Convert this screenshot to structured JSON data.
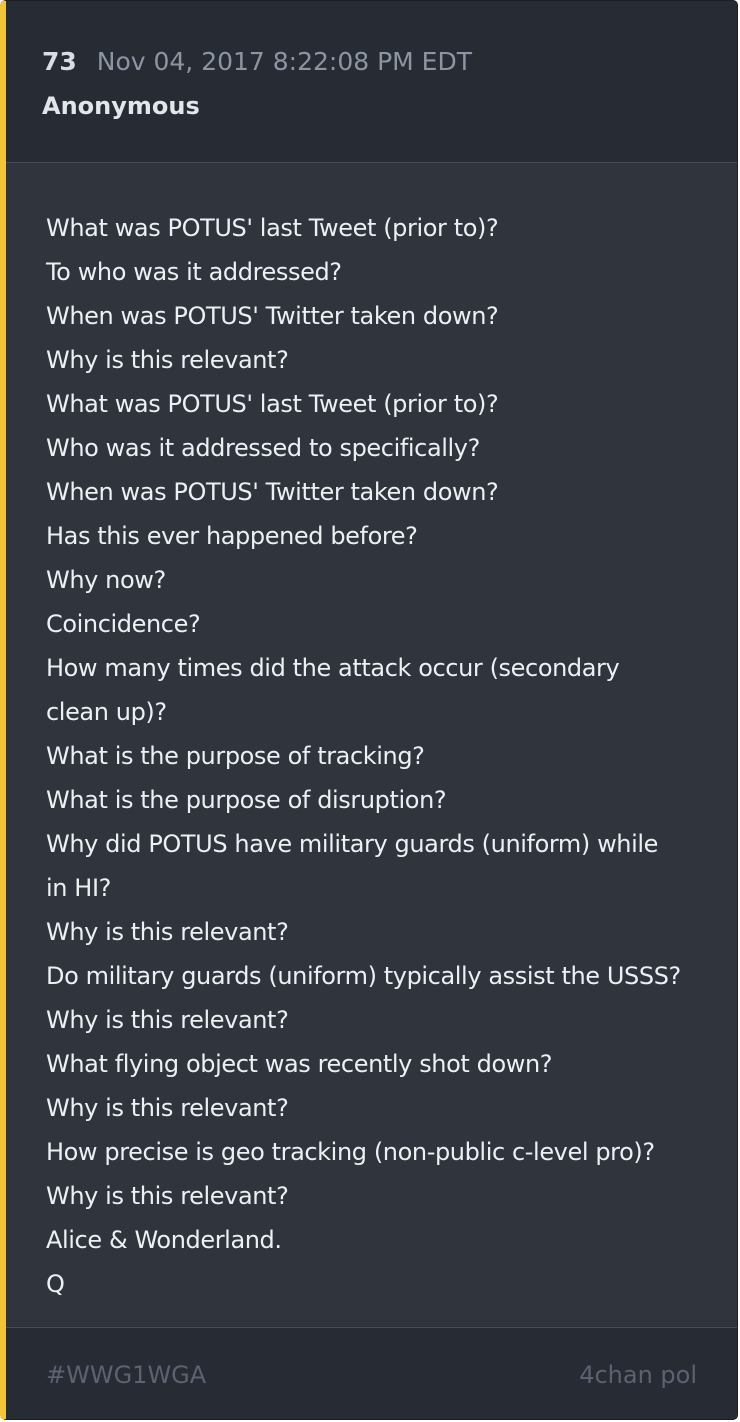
{
  "post": {
    "number": "73",
    "date": "Nov 04, 2017 8:22:08 PM EDT",
    "author": "Anonymous",
    "lines": [
      "What was POTUS' last Tweet (prior to)?",
      "To who was it addressed?",
      "When was POTUS' Twitter taken down?",
      "Why is this relevant?",
      "What was POTUS' last Tweet (prior to)?",
      "Who was it addressed to specifically?",
      "When was POTUS' Twitter taken down?",
      "Has this ever happened before?",
      "Why now?",
      "Coincidence?",
      "How many times did the attack occur (secondary",
      "clean up)?",
      "What is the purpose of tracking?",
      "What is the purpose of disruption?",
      "Why did POTUS have military guards (uniform) while",
      "in HI?",
      "Why is this relevant?",
      "Do military guards (uniform) typically assist the USSS?",
      "Why is this relevant?",
      "What flying object was recently shot down?",
      "Why is this relevant?",
      "How precise is geo tracking (non-public c-level pro)?",
      "Why is this relevant?",
      "Alice & Wonderland.",
      "Q"
    ]
  },
  "footer": {
    "hashtag": "#WWG1WGA",
    "source": "4chan pol"
  },
  "colors": {
    "accent_bar": "#f2c537",
    "card_background": "#2f343d",
    "header_background": "#272b33"
  }
}
